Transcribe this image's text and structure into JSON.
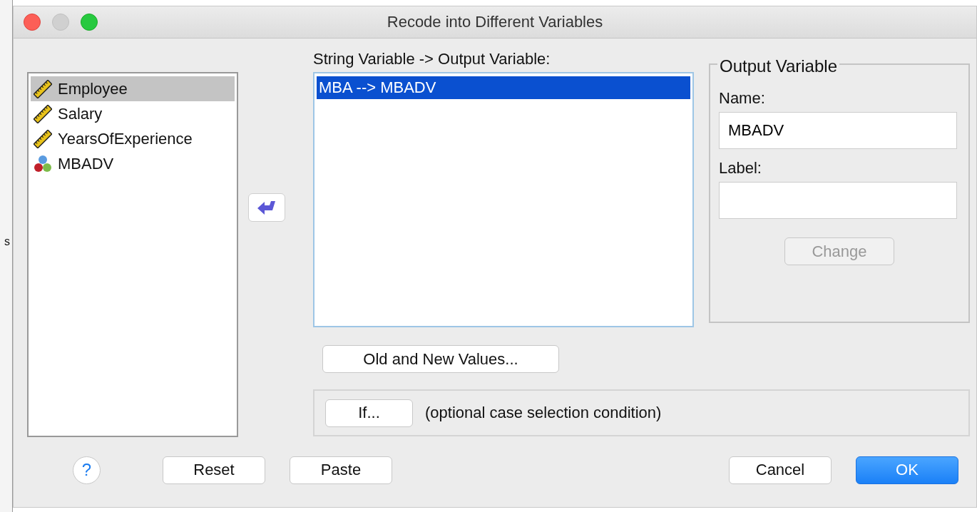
{
  "backdrop": {
    "letter": "s"
  },
  "window": {
    "title": "Recode into Different Variables"
  },
  "variables": [
    {
      "name": "Employee",
      "kind": "scale",
      "selected": true
    },
    {
      "name": "Salary",
      "kind": "scale",
      "selected": false
    },
    {
      "name": "YearsOfExperience",
      "kind": "scale",
      "selected": false
    },
    {
      "name": "MBADV",
      "kind": "nominal",
      "selected": false
    }
  ],
  "mapping": {
    "label": "String Variable -> Output Variable:",
    "items": [
      {
        "text": "MBA --> MBADV",
        "selected": true
      }
    ]
  },
  "output_variable": {
    "title": "Output Variable",
    "name_label": "Name:",
    "name_value": "MBADV",
    "label_label": "Label:",
    "change_button": {
      "label": "Change",
      "disabled": true
    }
  },
  "old_new_button": "Old and New Values...",
  "if_button": "If...",
  "if_note": "(optional case selection condition)",
  "footer": {
    "help": "?",
    "buttons": [
      {
        "label": "Reset",
        "default": false
      },
      {
        "label": "Paste",
        "default": false
      },
      {
        "label": "Cancel",
        "default": false
      },
      {
        "label": "OK",
        "default": true
      }
    ]
  }
}
